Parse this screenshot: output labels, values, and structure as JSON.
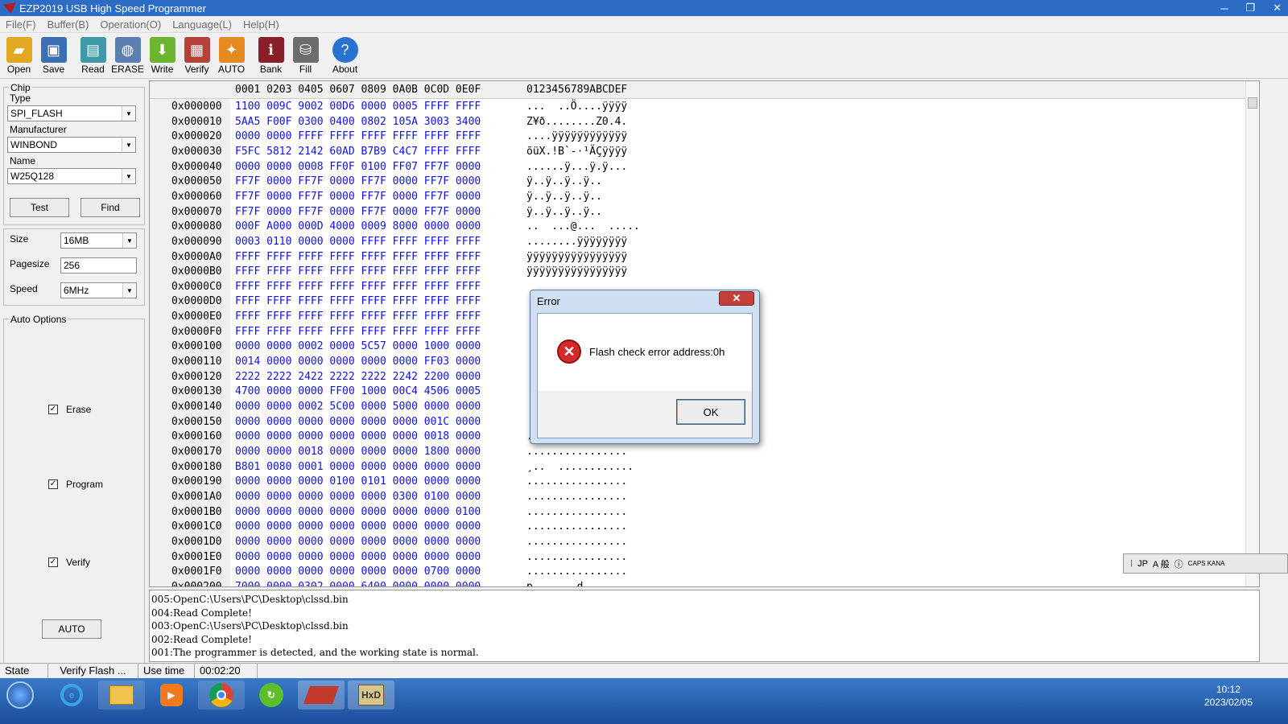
{
  "window": {
    "title": "EZP2019 USB High Speed Programmer",
    "minimize": "─",
    "restore": "❐",
    "close": "✕"
  },
  "menu": [
    "File(F)",
    "Buffer(B)",
    "Operation(O)",
    "Language(L)",
    "Help(H)"
  ],
  "toolbar": [
    {
      "label": "Open",
      "icon": "folder-icon",
      "color": "#e3a823"
    },
    {
      "label": "Save",
      "icon": "floppy-icon",
      "color": "#3a6fb5"
    },
    {
      "label": "Read",
      "icon": "read-chip-icon",
      "color": "#3e9aa8"
    },
    {
      "label": "ERASE",
      "icon": "eraser-bucket-icon",
      "color": "#5b7fb0"
    },
    {
      "label": "Write",
      "icon": "write-arrow-icon",
      "color": "#6bb531"
    },
    {
      "label": "Verify",
      "icon": "verify-checker-icon",
      "color": "#b5403a"
    },
    {
      "label": "AUTO",
      "icon": "running-man-icon",
      "color": "#e58a21"
    },
    {
      "label": "Bank",
      "icon": "bank-book-icon",
      "color": "#8a1f2a"
    },
    {
      "label": "Fill",
      "icon": "fill-bucket-icon",
      "color": "#6c6c6c"
    },
    {
      "label": "About",
      "icon": "help-icon",
      "color": "#2a72d0"
    }
  ],
  "chip": {
    "group_title": "Chip",
    "type_label": "Type",
    "type_value": "SPI_FLASH",
    "manufacturer_label": "Manufacturer",
    "manufacturer_value": "WINBOND",
    "name_label": "Name",
    "name_value": "W25Q128",
    "test_button": "Test",
    "find_button": "Find"
  },
  "params": {
    "size_label": "Size",
    "size_value": "16MB",
    "pagesize_label": "Pagesize",
    "pagesize_value": "256",
    "speed_label": "Speed",
    "speed_value": "6MHz"
  },
  "auto_options": {
    "title": "Auto Options",
    "erase_label": "Erase",
    "erase_checked": true,
    "program_label": "Program",
    "program_checked": true,
    "verify_label": "Verify",
    "verify_checked": true,
    "auto_button": "AUTO"
  },
  "hex": {
    "header_hex": "0001 0203 0405 0607 0809 0A0B 0C0D 0E0F",
    "header_ascii": "0123456789ABCDEF",
    "rows": [
      {
        "addr": "0x000000",
        "hex": "1100 009C 9002 00D6 0000 0005 FFFF FFFF",
        "ascii": "...  ..Ö....ÿÿÿÿ"
      },
      {
        "addr": "0x000010",
        "hex": "5AA5 F00F 0300 0400 0802 105A 3003 3400",
        "ascii": "Z¥ð........Z0.4."
      },
      {
        "addr": "0x000020",
        "hex": "0000 0000 FFFF FFFF FFFF FFFF FFFF FFFF",
        "ascii": "....ÿÿÿÿÿÿÿÿÿÿÿÿ"
      },
      {
        "addr": "0x000030",
        "hex": "F5FC 5812 2142 60AD B7B9 C4C7 FFFF FFFF",
        "ascii": "õüX.!B`-·¹ÄÇÿÿÿÿ"
      },
      {
        "addr": "0x000040",
        "hex": "0000 0000 0008 FF0F 0100 FF07 FF7F 0000",
        "ascii": "......ÿ...ÿ.ÿ..."
      },
      {
        "addr": "0x000050",
        "hex": "FF7F 0000 FF7F 0000 FF7F 0000 FF7F 0000",
        "ascii": "ÿ..ÿ..ÿ..ÿ.."
      },
      {
        "addr": "0x000060",
        "hex": "FF7F 0000 FF7F 0000 FF7F 0000 FF7F 0000",
        "ascii": "ÿ..ÿ..ÿ..ÿ.."
      },
      {
        "addr": "0x000070",
        "hex": "FF7F 0000 FF7F 0000 FF7F 0000 FF7F 0000",
        "ascii": "ÿ..ÿ..ÿ..ÿ.."
      },
      {
        "addr": "0x000080",
        "hex": "000F A000 000D 4000 0009 8000 0000 0000",
        "ascii": "..  ...@...  ....."
      },
      {
        "addr": "0x000090",
        "hex": "0003 0110 0000 0000 FFFF FFFF FFFF FFFF",
        "ascii": "........ÿÿÿÿÿÿÿÿ"
      },
      {
        "addr": "0x0000A0",
        "hex": "FFFF FFFF FFFF FFFF FFFF FFFF FFFF FFFF",
        "ascii": "ÿÿÿÿÿÿÿÿÿÿÿÿÿÿÿÿ"
      },
      {
        "addr": "0x0000B0",
        "hex": "FFFF FFFF FFFF FFFF FFFF FFFF FFFF FFFF",
        "ascii": "ÿÿÿÿÿÿÿÿÿÿÿÿÿÿÿÿ"
      },
      {
        "addr": "0x0000C0",
        "hex": "FFFF FFFF FFFF FFFF FFFF FFFF FFFF FFFF",
        "ascii": ""
      },
      {
        "addr": "0x0000D0",
        "hex": "FFFF FFFF FFFF FFFF FFFF FFFF FFFF FFFF",
        "ascii": ""
      },
      {
        "addr": "0x0000E0",
        "hex": "FFFF FFFF FFFF FFFF FFFF FFFF FFFF FFFF",
        "ascii": ""
      },
      {
        "addr": "0x0000F0",
        "hex": "FFFF FFFF FFFF FFFF FFFF FFFF FFFF FFFF",
        "ascii": ""
      },
      {
        "addr": "0x000100",
        "hex": "0000 0000 0002 0000 5C57 0000 1000 0000",
        "ascii": ""
      },
      {
        "addr": "0x000110",
        "hex": "0014 0000 0000 0000 0000 0000 FF03 0000",
        "ascii": ""
      },
      {
        "addr": "0x000120",
        "hex": "2222 2222 2422 2222 2222 2242 2200 0000",
        "ascii": ""
      },
      {
        "addr": "0x000130",
        "hex": "4700 0000 0000 FF00 1000 00C4 4506 0005",
        "ascii": ""
      },
      {
        "addr": "0x000140",
        "hex": "0000 0000 0002 5C00 0000 5000 0000 0000",
        "ascii": ""
      },
      {
        "addr": "0x000150",
        "hex": "0000 0000 0000 0000 0000 0000 001C 0000",
        "ascii": ""
      },
      {
        "addr": "0x000160",
        "hex": "0000 0000 0000 0000 0000 0000 0018 0000",
        "ascii": "................"
      },
      {
        "addr": "0x000170",
        "hex": "0000 0000 0018 0000 0000 0000 1800 0000",
        "ascii": "................"
      },
      {
        "addr": "0x000180",
        "hex": "B801 0080 0001 0000 0000 0000 0000 0000",
        "ascii": "¸..  ............"
      },
      {
        "addr": "0x000190",
        "hex": "0000 0000 0000 0100 0101 0000 0000 0000",
        "ascii": "................"
      },
      {
        "addr": "0x0001A0",
        "hex": "0000 0000 0000 0000 0000 0300 0100 0000",
        "ascii": "................"
      },
      {
        "addr": "0x0001B0",
        "hex": "0000 0000 0000 0000 0000 0000 0000 0100",
        "ascii": "................"
      },
      {
        "addr": "0x0001C0",
        "hex": "0000 0000 0000 0000 0000 0000 0000 0000",
        "ascii": "................"
      },
      {
        "addr": "0x0001D0",
        "hex": "0000 0000 0000 0000 0000 0000 0000 0000",
        "ascii": "................"
      },
      {
        "addr": "0x0001E0",
        "hex": "0000 0000 0000 0000 0000 0000 0000 0000",
        "ascii": "................"
      },
      {
        "addr": "0x0001F0",
        "hex": "0000 0000 0000 0000 0000 0000 0700 0000",
        "ascii": "................"
      },
      {
        "addr": "0x000200",
        "hex": "7000 0000 0302 0000 6400 0000 0000 0000",
        "ascii": "p.......d......."
      }
    ]
  },
  "log": [
    "005:OpenC:\\Users\\PC\\Desktop\\clssd.bin",
    "004:Read Complete!",
    "003:OpenC:\\Users\\PC\\Desktop\\clssd.bin",
    "002:Read Complete!",
    "001:The programmer is detected, and the working state is normal."
  ],
  "status": {
    "state_label": "State",
    "state_value": "Verify Flash ...",
    "time_label": "Use time",
    "time_value": "00:02:20"
  },
  "dialog": {
    "title": "Error",
    "message": "Flash check error address:0h",
    "ok": "OK",
    "close": "✕",
    "icon": "error-icon"
  },
  "ime": {
    "lang": "JP",
    "mode": "A 般",
    "caps": "CAPS KANA"
  },
  "taskbar": {
    "start": "start-orb-icon",
    "apps": [
      "internet-explorer-icon",
      "file-explorer-icon",
      "media-player-icon",
      "chrome-icon",
      "refresh-app-icon",
      "bios-programmer-icon",
      "hxd-icon"
    ],
    "time": "10:12",
    "date": "2023/02/05"
  }
}
